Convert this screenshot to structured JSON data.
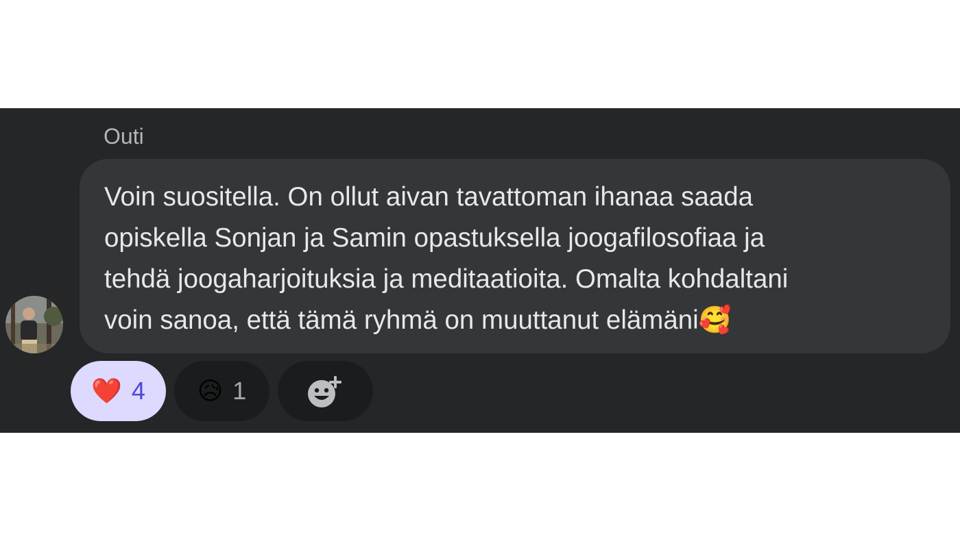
{
  "sender": {
    "name": "Outi"
  },
  "message": {
    "lines": [
      "Voin suositella. On ollut aivan tavattoman ihanaa saada",
      "opiskella Sonjan ja Samin opastuksella joogafilosofiaa ja",
      "tehdä joogaharjoituksia ja meditaatioita. Omalta kohdaltani",
      "voin sanoa, että tämä ryhmä on muuttanut elämäni🥰"
    ]
  },
  "reactions": [
    {
      "emoji": "❤️",
      "icon": "heart-icon",
      "count": "4",
      "selected": true
    },
    {
      "emoji": "😥",
      "icon": "sad-face-icon",
      "count": "1",
      "selected": false
    }
  ],
  "add_reaction": {
    "icon": "add-reaction-icon"
  },
  "colors": {
    "panel": "#252627",
    "bubble": "#353637",
    "selected_pill": "#ddd9ff",
    "selected_count": "#4c47d6"
  }
}
